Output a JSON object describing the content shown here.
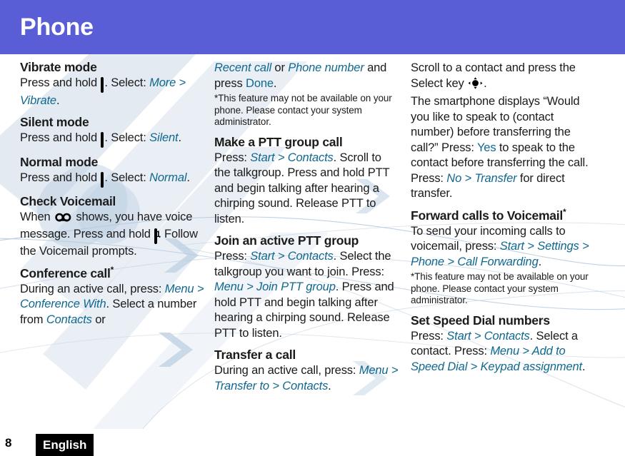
{
  "header": {
    "title": "Phone",
    "bg_color": "#5a5ed6",
    "text_color": "#ffffff"
  },
  "accent_color": "#10688f",
  "columns": [
    {
      "id": "column-1",
      "sections": [
        {
          "heading": "Vibrate mode",
          "body_runs": [
            {
              "text": "Press and hold ",
              "style": "plain"
            },
            {
              "text": "home-key-icon",
              "style": "icon"
            },
            {
              "text": ". Select: ",
              "style": "plain"
            },
            {
              "text": "More > Vibrate",
              "style": "menu"
            },
            {
              "text": ".",
              "style": "plain"
            }
          ]
        },
        {
          "heading": "Silent mode",
          "body_runs": [
            {
              "text": "Press and hold ",
              "style": "plain"
            },
            {
              "text": "home-key-icon",
              "style": "icon"
            },
            {
              "text": ". Select: ",
              "style": "plain"
            },
            {
              "text": "Silent",
              "style": "menu"
            },
            {
              "text": ".",
              "style": "plain"
            }
          ]
        },
        {
          "heading": "Normal mode",
          "body_runs": [
            {
              "text": "Press and hold ",
              "style": "plain"
            },
            {
              "text": "home-key-icon",
              "style": "icon"
            },
            {
              "text": ". Select: ",
              "style": "plain"
            },
            {
              "text": "Normal",
              "style": "menu"
            },
            {
              "text": ".",
              "style": "plain"
            }
          ]
        },
        {
          "heading": "Check Voicemail",
          "body_runs": [
            {
              "text": "When ",
              "style": "plain"
            },
            {
              "text": "voicemail-icon",
              "style": "icon"
            },
            {
              "text": " shows, you have voice message. Press and hold ",
              "style": "plain"
            },
            {
              "text": "key-1-icon",
              "style": "icon"
            },
            {
              "text": ". Follow the Voicemail prompts.",
              "style": "plain"
            }
          ]
        },
        {
          "heading": "Conference call",
          "heading_star": "*",
          "body_runs": [
            {
              "text": "During an active call, press: ",
              "style": "plain"
            },
            {
              "text": "Menu > Conference With",
              "style": "menu"
            },
            {
              "text": ". Select a number from ",
              "style": "plain"
            },
            {
              "text": "Contacts",
              "style": "menu"
            },
            {
              "text": " or",
              "style": "plain"
            }
          ]
        }
      ]
    },
    {
      "id": "column-2",
      "sections": [
        {
          "heading": null,
          "body_runs": [
            {
              "text": "Recent call",
              "style": "menu"
            },
            {
              "text": " or ",
              "style": "plain"
            },
            {
              "text": "Phone number",
              "style": "menu"
            },
            {
              "text": " and press ",
              "style": "plain"
            },
            {
              "text": "Done",
              "style": "soft"
            },
            {
              "text": ".",
              "style": "plain"
            }
          ],
          "footnote": {
            "marker": "*",
            "text": "This feature may not be available on your phone. Please contact your system administrator."
          }
        },
        {
          "heading": "Make a PTT group call",
          "body_runs": [
            {
              "text": "Press: ",
              "style": "plain"
            },
            {
              "text": "Start > Contacts",
              "style": "menu"
            },
            {
              "text": ". Scroll to the talkgroup. Press and hold PTT and begin talking after hearing a chirping sound. Release PTT to listen.",
              "style": "plain"
            }
          ]
        },
        {
          "heading": "Join an active PTT group",
          "body_runs": [
            {
              "text": "Press: ",
              "style": "plain"
            },
            {
              "text": "Start > Contacts",
              "style": "menu"
            },
            {
              "text": ". Select the talkgroup you want to join. Press: ",
              "style": "plain"
            },
            {
              "text": "Menu > Join PTT group",
              "style": "menu"
            },
            {
              "text": ". Press and hold PTT and begin talking after hearing a chirping sound. Release PTT to listen.",
              "style": "plain"
            }
          ]
        },
        {
          "heading": "Transfer a call",
          "body_runs": [
            {
              "text": "During an active call, press: ",
              "style": "plain"
            },
            {
              "text": "Menu > Transfer to > Contacts",
              "style": "menu"
            },
            {
              "text": ".",
              "style": "plain"
            }
          ]
        }
      ]
    },
    {
      "id": "column-3",
      "sections": [
        {
          "heading": null,
          "body_runs": [
            {
              "text": "Scroll to a contact and press the Select key ",
              "style": "plain"
            },
            {
              "text": "select-key-icon",
              "style": "icon"
            },
            {
              "text": ".",
              "style": "plain"
            }
          ]
        },
        {
          "heading": null,
          "body_runs": [
            {
              "text": "The smartphone displays “Would you like to speak to (contact number) before transferring the call?” Press: ",
              "style": "plain"
            },
            {
              "text": "Yes",
              "style": "soft"
            },
            {
              "text": " to speak to the contact before transferring the call. Press: ",
              "style": "plain"
            },
            {
              "text": "No > Transfer",
              "style": "menu"
            },
            {
              "text": " for direct transfer.",
              "style": "plain"
            }
          ]
        },
        {
          "heading": "Forward calls to Voicemail",
          "heading_star": "*",
          "body_runs": [
            {
              "text": "To send your incoming calls to voicemail, press: ",
              "style": "plain"
            },
            {
              "text": "Start > Settings > Phone > Call Forwarding",
              "style": "menu"
            },
            {
              "text": ".",
              "style": "plain"
            }
          ],
          "footnote": {
            "marker": "*",
            "text": "This feature may not be available on your phone. Please contact your system administrator."
          }
        },
        {
          "heading": "Set Speed Dial numbers",
          "body_runs": [
            {
              "text": "Press: ",
              "style": "plain"
            },
            {
              "text": "Start > Contacts",
              "style": "menu"
            },
            {
              "text": ". Select a contact. Press: ",
              "style": "plain"
            },
            {
              "text": "Menu > Add to Speed Dial > Keypad assignment",
              "style": "menu"
            },
            {
              "text": ".",
              "style": "plain"
            }
          ]
        }
      ]
    }
  ],
  "footer": {
    "page_number": "8",
    "language": "English",
    "badge_bg": "#000000",
    "badge_text_color": "#ffffff"
  }
}
